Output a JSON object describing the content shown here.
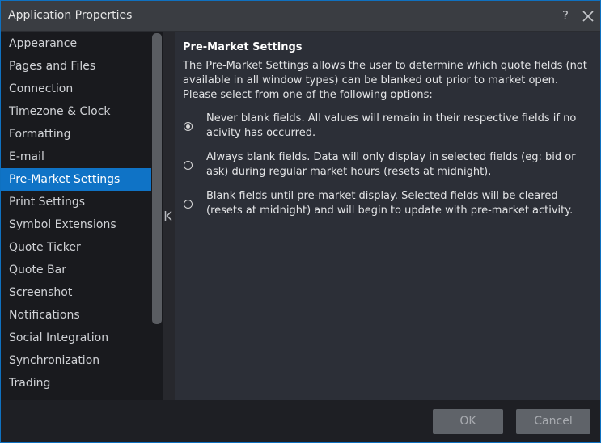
{
  "window": {
    "title": "Application Properties",
    "help_label": "?",
    "accent_color": "#0f73c6"
  },
  "sidebar": {
    "items": [
      {
        "label": "Appearance"
      },
      {
        "label": "Pages and Files"
      },
      {
        "label": "Connection"
      },
      {
        "label": "Timezone & Clock"
      },
      {
        "label": "Formatting"
      },
      {
        "label": "E-mail"
      },
      {
        "label": "Pre-Market Settings",
        "selected": true
      },
      {
        "label": "Print Settings"
      },
      {
        "label": "Symbol Extensions"
      },
      {
        "label": "Quote Ticker"
      },
      {
        "label": "Quote Bar"
      },
      {
        "label": "Screenshot"
      },
      {
        "label": "Notifications"
      },
      {
        "label": "Social Integration"
      },
      {
        "label": "Synchronization"
      },
      {
        "label": "Trading"
      }
    ]
  },
  "content": {
    "heading": "Pre-Market Settings",
    "description": "The Pre-Market Settings allows the user to determine which quote fields (not available in all window types) can be blanked out prior to market open. Please select from one of the following options:",
    "options": [
      {
        "label": "Never blank fields. All values will remain in their respective fields if no acivity has occurred.",
        "checked": true
      },
      {
        "label": "Always blank fields. Data will only display in selected fields (eg: bid or ask) during regular market hours (resets at midnight).",
        "checked": false
      },
      {
        "label": "Blank fields until pre-market display. Selected fields will be cleared (resets at midnight) and will begin to update with pre-market activity.",
        "checked": false
      }
    ]
  },
  "footer": {
    "ok_label": "OK",
    "cancel_label": "Cancel"
  },
  "icons": {
    "help": "question-mark-icon",
    "close": "close-icon",
    "collapse": "collapse-left-icon"
  }
}
